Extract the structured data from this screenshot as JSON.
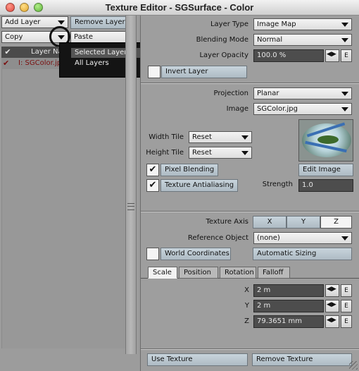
{
  "window": {
    "title": "Texture Editor - SGSurface - Color"
  },
  "left": {
    "add_layer": "Add Layer",
    "remove_layer": "Remove Layer",
    "copy": "Copy",
    "paste": "Paste",
    "column_layer_name": "Layer Na",
    "layer_row": "I: SGColor.jp",
    "copy_menu": {
      "items": [
        "Selected Layer(s)",
        "All Layers"
      ]
    }
  },
  "layer": {
    "layer_type_label": "Layer Type",
    "layer_type_value": "Image Map",
    "blending_mode_label": "Blending Mode",
    "blending_mode_value": "Normal",
    "opacity_label": "Layer Opacity",
    "opacity_value": "100.0 %",
    "invert_label": "Invert Layer"
  },
  "projection": {
    "projection_label": "Projection",
    "projection_value": "Planar",
    "image_label": "Image",
    "image_value": "SGColor.jpg",
    "width_tile_label": "Width Tile",
    "width_tile_value": "Reset",
    "height_tile_label": "Height Tile",
    "height_tile_value": "Reset",
    "pixel_blending": "Pixel Blending",
    "texture_antialiasing": "Texture Antialiasing",
    "edit_image": "Edit Image",
    "strength_label": "Strength",
    "strength_value": "1.0"
  },
  "axis": {
    "texture_axis_label": "Texture Axis",
    "axes": [
      "X",
      "Y",
      "Z"
    ],
    "selected_axis": "Z",
    "reference_object_label": "Reference Object",
    "reference_object_value": "(none)",
    "world_coordinates": "World Coordinates",
    "automatic_sizing": "Automatic Sizing"
  },
  "tabs": [
    "Scale",
    "Position",
    "Rotation",
    "Falloff"
  ],
  "active_tab": "Scale",
  "scale": {
    "x_label": "X",
    "x_value": "2 m",
    "y_label": "Y",
    "y_value": "2 m",
    "z_label": "Z",
    "z_value": "79.3651 mm",
    "env_button": "E"
  },
  "footer": {
    "use_texture": "Use Texture",
    "remove_texture": "Remove Texture"
  }
}
